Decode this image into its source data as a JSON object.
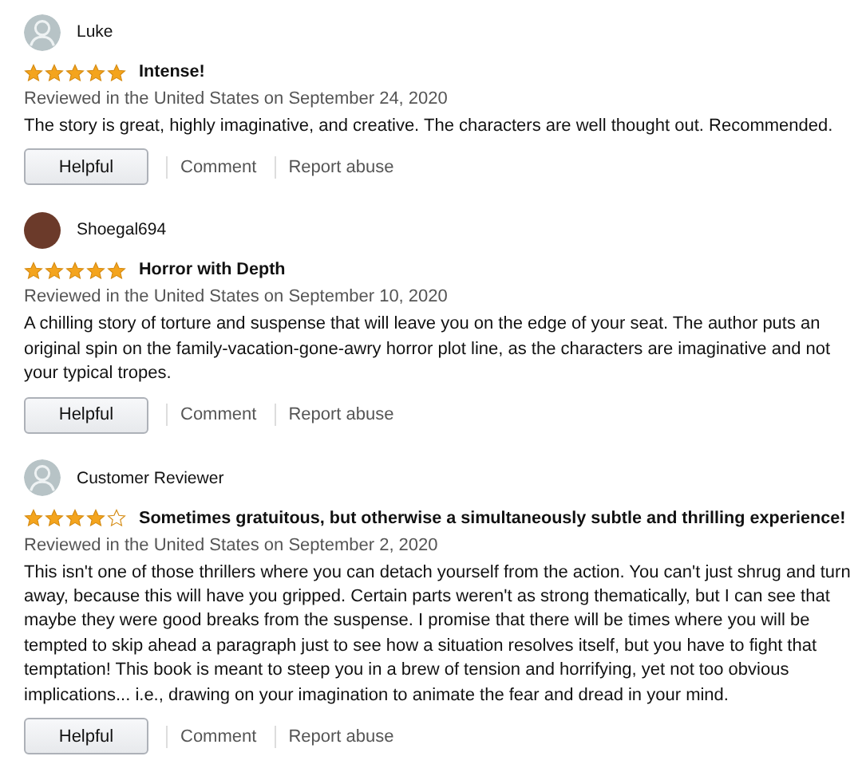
{
  "reviews": [
    {
      "reviewer": "Luke",
      "kind": "default",
      "stars": 5,
      "title": "Intense!",
      "date": "Reviewed in the United States on September 24, 2020",
      "body": "The story is great, highly imaginative, and creative. The characters are well thought out. Recommended.",
      "helpful": "Helpful",
      "comment": "Comment",
      "report": "Report abuse"
    },
    {
      "reviewer": "Shoegal694",
      "kind": "photo",
      "stars": 5,
      "title": "Horror with Depth",
      "date": "Reviewed in the United States on September 10, 2020",
      "body": "A chilling story of torture and suspense that will leave you on the edge of your seat. The author puts an original spin on the family-vacation-gone-awry horror plot line, as the characters are imaginative and not your typical tropes.",
      "helpful": "Helpful",
      "comment": "Comment",
      "report": "Report abuse"
    },
    {
      "reviewer": "Customer Reviewer",
      "kind": "default",
      "stars": 4,
      "title": "Sometimes gratuitous, but otherwise a simultaneously subtle and thrilling experience!",
      "date": "Reviewed in the United States on September 2, 2020",
      "body": "This isn't one of those thrillers where you can detach yourself from the action. You can't just shrug and turn away, because this will have you gripped. Certain parts weren't as strong thematically, but I can see that maybe they were good breaks from the suspense. I promise that there will be times where you will be tempted to skip ahead a paragraph just to see how a situation resolves itself, but you have to fight that temptation! This book is meant to steep you in a brew of tension and horrifying, yet not too obvious implications... i.e., drawing on your imagination to animate the fear and dread in your mind.",
      "helpful": "Helpful",
      "comment": "Comment",
      "report": "Report abuse"
    }
  ]
}
